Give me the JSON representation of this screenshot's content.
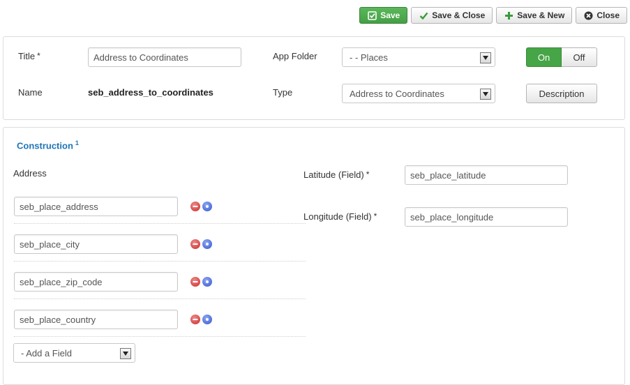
{
  "toolbar": {
    "save": "Save",
    "save_close": "Save & Close",
    "save_new": "Save & New",
    "close": "Close"
  },
  "general": {
    "title_label": "Title",
    "title_required": "*",
    "title_value": "Address to Coordinates",
    "app_folder_label": "App Folder",
    "app_folder_value": "- - Places",
    "state_on": "On",
    "state_off": "Off",
    "state_selected": "On",
    "name_label": "Name",
    "name_value": "seb_address_to_coordinates",
    "type_label": "Type",
    "type_value": "Address to Coordinates",
    "description_button": "Description"
  },
  "construction": {
    "title": "Construction",
    "footnote": "1",
    "address_label": "Address",
    "address_fields": [
      "seb_place_address",
      "seb_place_city",
      "seb_place_zip_code",
      "seb_place_country"
    ],
    "add_field": "- Add a Field",
    "latitude_label": "Latitude (Field)",
    "latitude_required": "*",
    "latitude_value": "seb_place_latitude",
    "longitude_label": "Longitude (Field)",
    "longitude_required": "*",
    "longitude_value": "seb_place_longitude"
  },
  "colors": {
    "save_green": "#5bb75b",
    "toggle_on_green": "#46a546",
    "section_title_blue": "#1f74b6",
    "remove_red": "#c82a2a",
    "move_blue": "#3355cc"
  },
  "icons": {
    "save": "checkbox-save-icon",
    "save_close": "check-icon",
    "save_new": "plus-icon",
    "close": "close-circle-icon",
    "remove": "minus-circle-icon",
    "move": "dot-circle-icon"
  }
}
